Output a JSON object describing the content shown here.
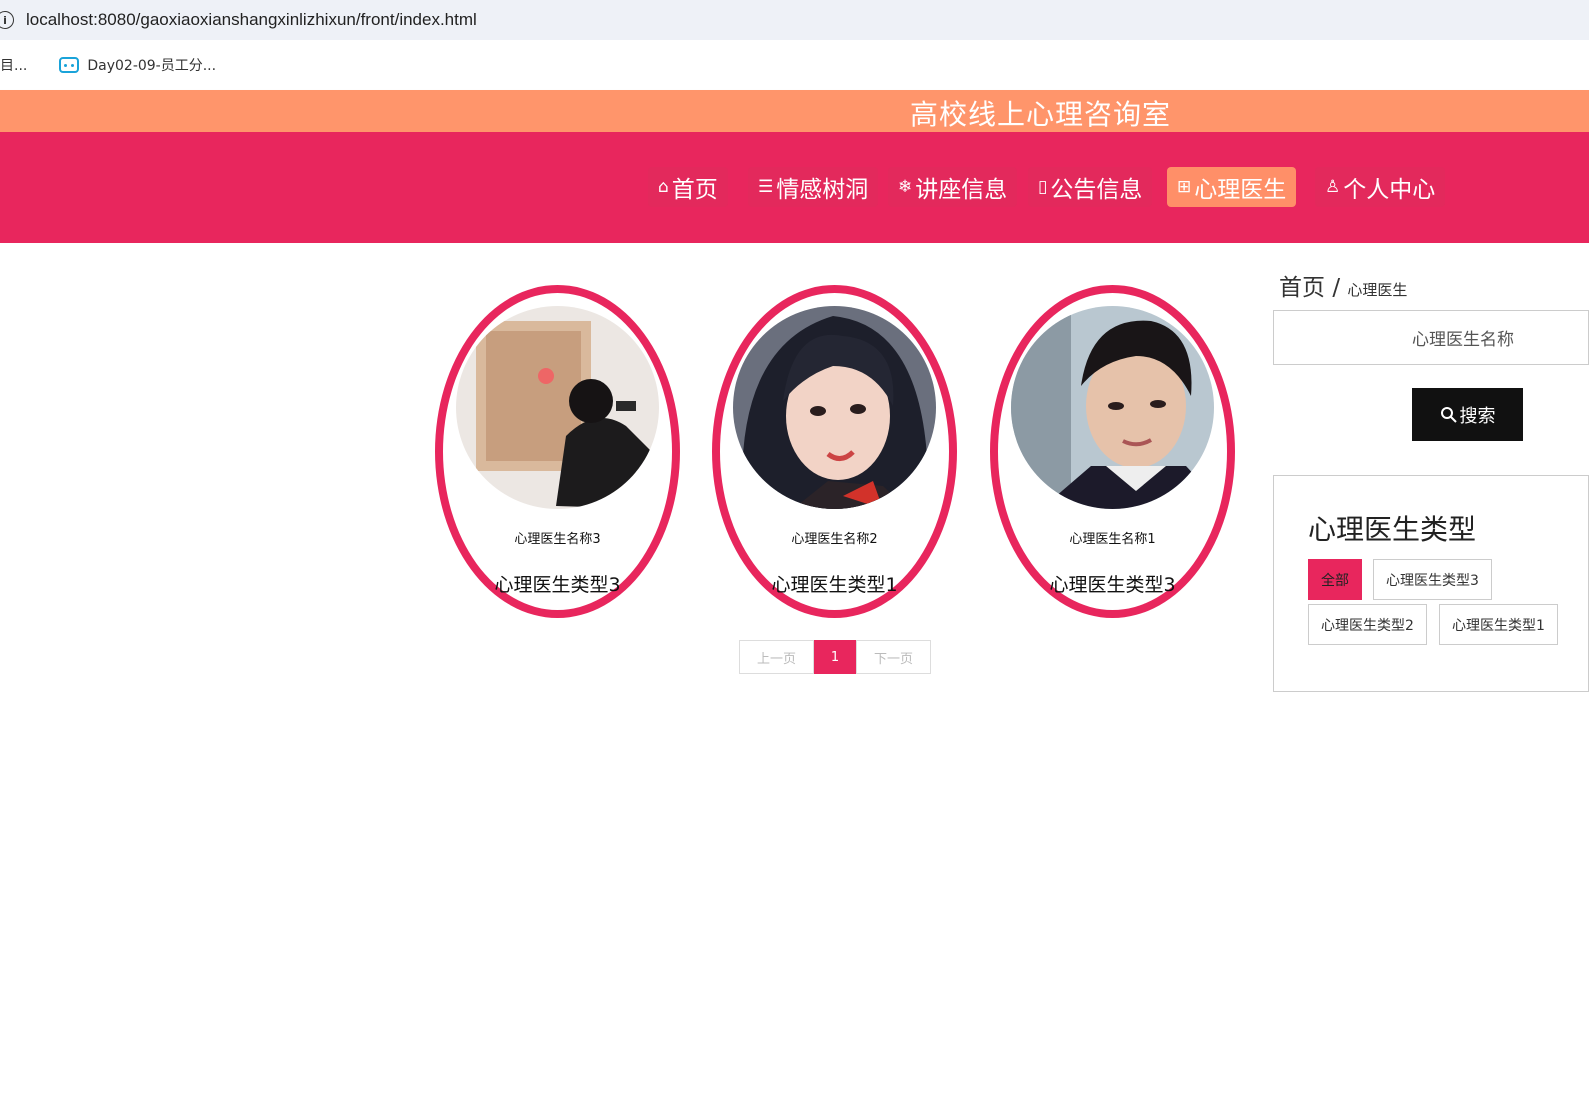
{
  "browser": {
    "url_host": "localhost",
    "url_rest": ":8080/gaoxiaoxianshangxinlizhixun/front/index.html",
    "bookmarks": [
      "目...",
      "Day02-09-员工分..."
    ]
  },
  "header": {
    "site_title": "高校线上心理咨询室"
  },
  "nav": [
    {
      "icon": "home-icon",
      "glyph": "⌂",
      "label": "首页"
    },
    {
      "icon": "layers-icon",
      "glyph": "☰",
      "label": "情感树洞"
    },
    {
      "icon": "snowflake-icon",
      "glyph": "❄",
      "label": "讲座信息"
    },
    {
      "icon": "note-icon",
      "glyph": "▯",
      "label": "公告信息"
    },
    {
      "icon": "gift-icon",
      "glyph": "⊞",
      "label": "心理医生",
      "active": true
    },
    {
      "icon": "user-icon",
      "glyph": "♙",
      "label": "个人中心"
    }
  ],
  "doctors": [
    {
      "name": "心理医生名称3",
      "type": "心理医生类型3"
    },
    {
      "name": "心理医生名称2",
      "type": "心理医生类型1"
    },
    {
      "name": "心理医生名称1",
      "type": "心理医生类型3"
    }
  ],
  "pager": {
    "prev": "上一页",
    "current": "1",
    "next": "下一页"
  },
  "breadcrumb": {
    "home": "首页",
    "sep": "/",
    "current": "心理医生"
  },
  "search": {
    "placeholder": "心理医生名称",
    "button": "搜索"
  },
  "types": {
    "title": "心理医生类型",
    "items": [
      "全部",
      "心理医生类型3",
      "心理医生类型2",
      "心理医生类型1"
    ]
  },
  "colors": {
    "primary": "#e8265d",
    "accent": "#ff956b"
  }
}
